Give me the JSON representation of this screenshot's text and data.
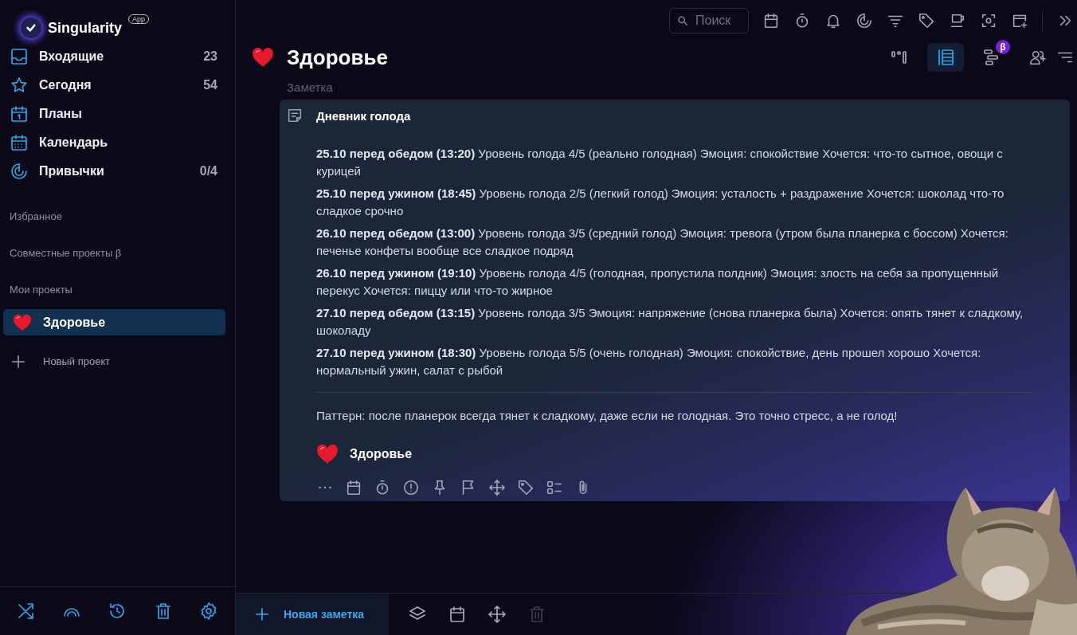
{
  "app": {
    "name": "Singularity",
    "badge": "App"
  },
  "nav": [
    {
      "label": "Входящие",
      "count": "23"
    },
    {
      "label": "Сегодня",
      "count": "54"
    },
    {
      "label": "Планы"
    },
    {
      "label": "Календарь"
    },
    {
      "label": "Привычки",
      "count": "0/4"
    }
  ],
  "sections": [
    "Избранное",
    "Совместные проекты β",
    "Мои проекты"
  ],
  "projects": [
    {
      "label": "Здоровье",
      "selected": true
    }
  ],
  "new_project": "Новый проект",
  "toolbar": {
    "search": {
      "placeholder": "Поиск"
    }
  },
  "views": [
    {
      "selected": false
    },
    {
      "selected": true
    },
    {
      "selected": false,
      "badge": "β"
    }
  ],
  "header": {
    "title": "Здоровье",
    "subtitle": "Заметка"
  },
  "note": {
    "title": "Дневник голода",
    "entries": [
      "**25.10 перед обедом (13:20)** Уровень голода 4/5 (реально голодная) Эмоция: спокойствие Хочется: что-то сытное, овощи с курицей",
      "**25.10 перед ужином (18:45)** Уровень голода 2/5 (легкий голод) Эмоция: усталость +  раздражение Хочется: шоколад что-то сладкое срочно",
      "**26.10 перед обедом (13:00)** Уровень голода 3/5 (средний голод) Эмоция: тревога (утром была планерка с боссом) Хочется: печенье конфеты вообще все сладкое подряд",
      "**26.10 перед ужином (19:10)** Уровень голода 4/5 (голодная, пропустила полдник) Эмоция: злость на себя за пропущенный перекус Хочется: пиццу или что-то жирное",
      "**27.10 перед обедом (13:15)** Уровень голода 3/5 Эмоция: напряжение (снова планерка была) Хочется: опять тянет к сладкому, шоколаду",
      "**27.10 перед ужином (18:30)** Уровень голода 5/5 (очень голодная) Эмоция: спокойствие, день прошел хорошо Хочется: нормальный ужин, салат с рыбой"
    ],
    "conclusion": "Паттерн: после планерок всегда тянет к сладкому, даже если не голодная. Это точно стресс, а не голод!",
    "project": "Здоровье"
  },
  "bottom_bar": {
    "new_note": "Новая заметка",
    "delete": {
      "disabled": true
    }
  }
}
